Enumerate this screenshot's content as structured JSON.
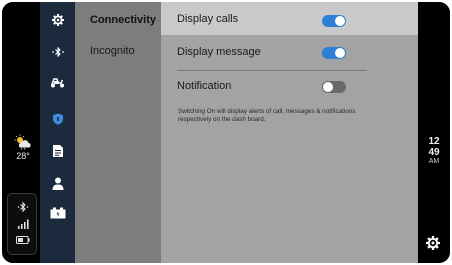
{
  "weather": {
    "icon": "sun-cloud-rain-icon",
    "temperature": "28°"
  },
  "status": {
    "bluetooth_icon": "bluetooth-icon",
    "signal_icon": "signal-bars-icon",
    "battery_icon": "battery-icon"
  },
  "nav": {
    "items": [
      {
        "name": "nav-item-settings",
        "icon": "gear-icon",
        "active": false
      },
      {
        "name": "nav-item-bluetooth",
        "icon": "bluetooth-icon",
        "active": false
      },
      {
        "name": "nav-item-scooter",
        "icon": "scooter-icon",
        "active": false
      },
      {
        "name": "nav-item-privacy",
        "icon": "shield-icon",
        "active": true
      },
      {
        "name": "nav-item-document",
        "icon": "document-icon",
        "active": false
      },
      {
        "name": "nav-item-profile",
        "icon": "person-icon",
        "active": false
      },
      {
        "name": "nav-item-battery",
        "icon": "battery-charge-icon",
        "active": false
      }
    ]
  },
  "submenu": {
    "items": [
      {
        "label": "Connectivity",
        "active": true
      },
      {
        "label": "Incognito",
        "active": false
      }
    ]
  },
  "settings": {
    "rows": [
      {
        "label": "Display calls",
        "enabled": true
      },
      {
        "label": "Display message",
        "enabled": true
      },
      {
        "label": "Notification",
        "enabled": false
      }
    ],
    "note": "Switching On will display alerts of call, messages & notifications respectively on the dash board."
  },
  "clock": {
    "hour": "12",
    "minute": "49",
    "period": "AM"
  },
  "colors": {
    "accent": "#2e7fd6",
    "nav_bg": "#1b2a3c",
    "nav_active": "#3d8de0"
  }
}
